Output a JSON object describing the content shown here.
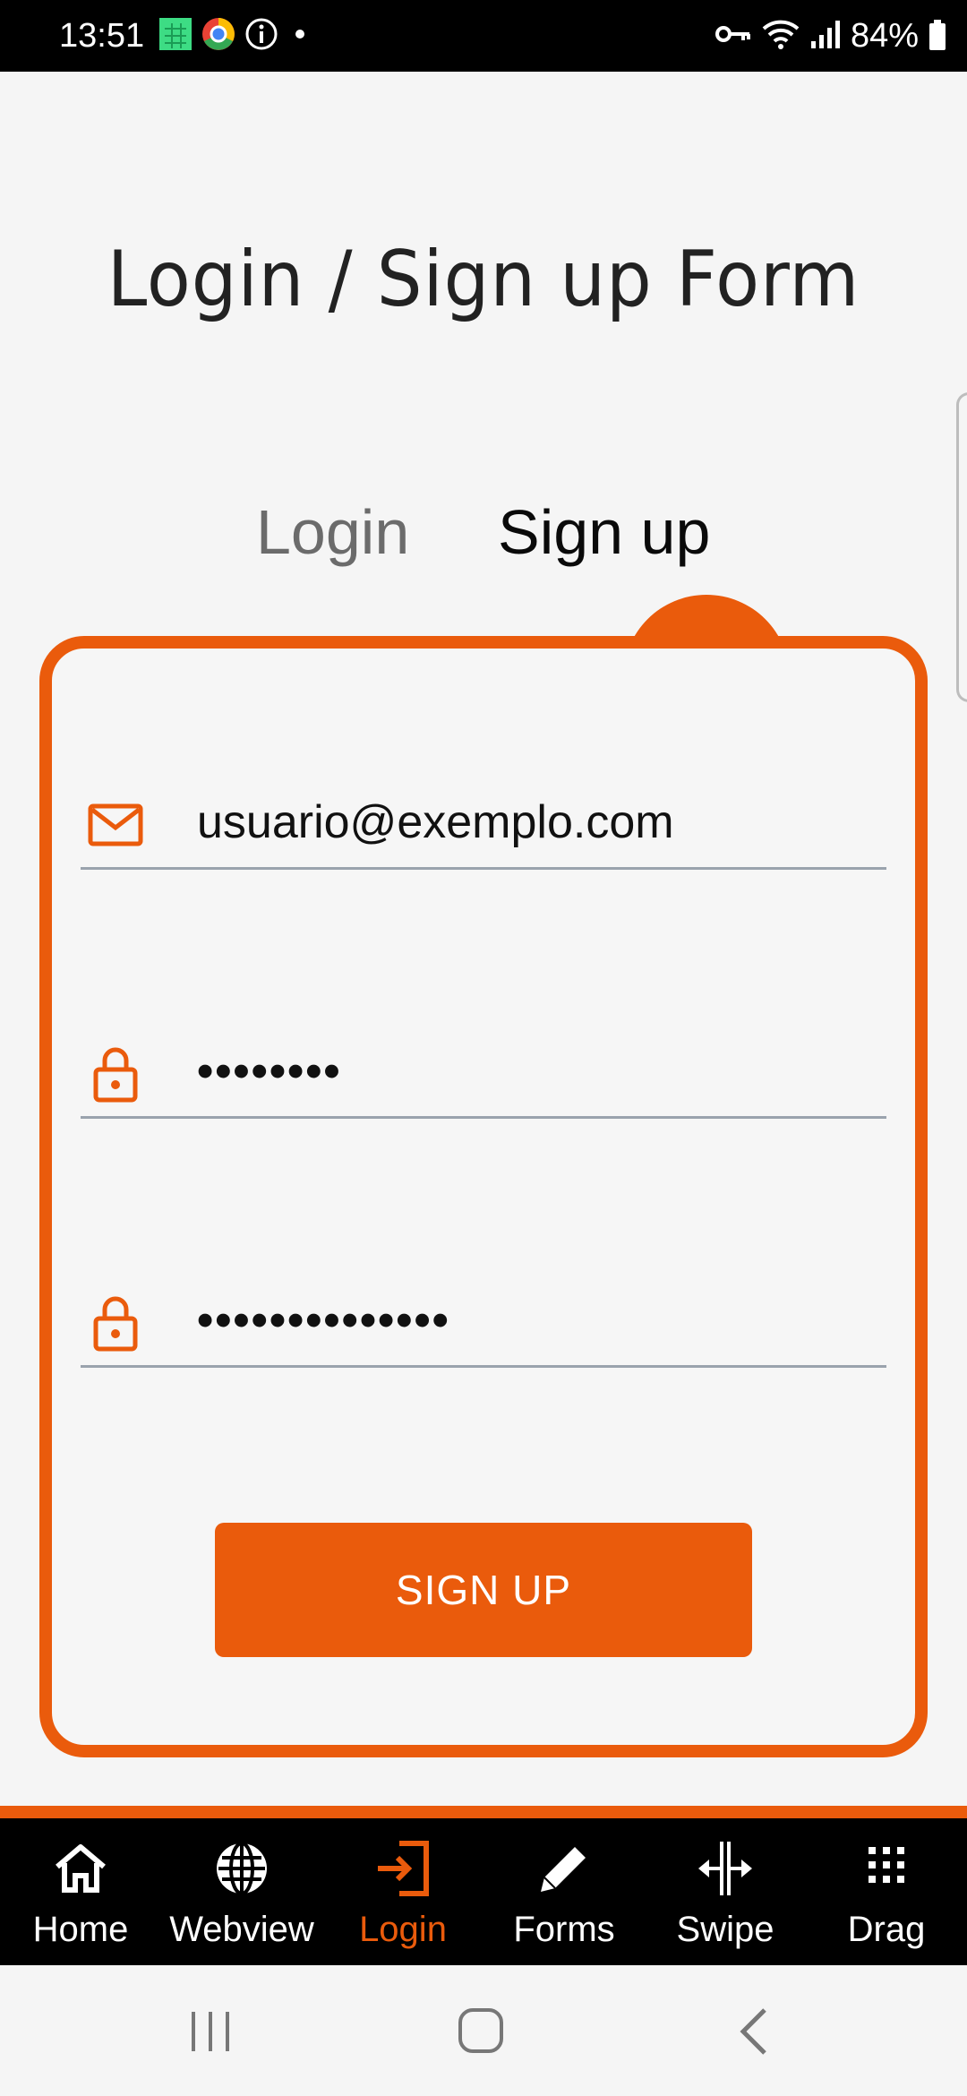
{
  "status_bar": {
    "time": "13:51",
    "battery": "84%"
  },
  "title": "Login / Sign up Form",
  "tabs": {
    "login": "Login",
    "signup": "Sign up"
  },
  "form": {
    "email": "usuario@exemplo.com",
    "password": "••••••••",
    "confirm_password": "••••••••••••••",
    "signup_button": "SIGN UP"
  },
  "bottom_nav": {
    "items": [
      {
        "label": "Home",
        "icon": "home-icon"
      },
      {
        "label": "Webview",
        "icon": "globe-icon"
      },
      {
        "label": "Login",
        "icon": "login-icon",
        "active": true
      },
      {
        "label": "Forms",
        "icon": "pencil-icon"
      },
      {
        "label": "Swipe",
        "icon": "swipe-icon"
      },
      {
        "label": "Drag",
        "icon": "grid-icon"
      }
    ]
  },
  "colors": {
    "accent": "#ea5b0c",
    "background": "#f5f5f5",
    "nav_bg": "#000000"
  }
}
